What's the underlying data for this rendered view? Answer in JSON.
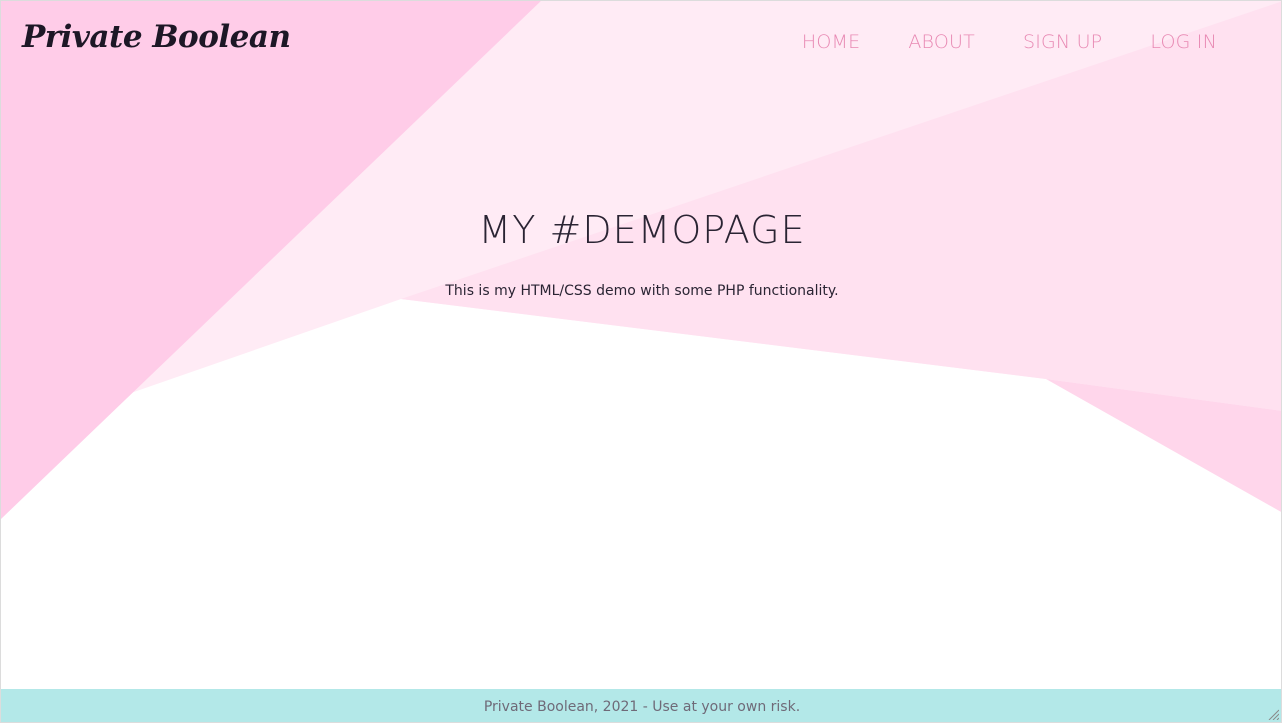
{
  "brand": {
    "logo_text": "Private Boolean"
  },
  "nav": {
    "items": [
      {
        "label": "HOME"
      },
      {
        "label": "ABOUT"
      },
      {
        "label": "SIGN UP"
      },
      {
        "label": "LOG IN"
      }
    ]
  },
  "hero": {
    "title": "MY #DEMOPAGE",
    "subtitle": "This is my HTML/CSS demo with some PHP functionality."
  },
  "footer": {
    "text": "Private Boolean, 2021 - Use at your own risk."
  },
  "colors": {
    "background": "#ffffff",
    "pink_strong": "#ffcce8",
    "pink_light": "#ffebf5",
    "pink_mid": "#ffe1f0",
    "nav_text": "#e889b3",
    "footer_bg": "#b3e8e8",
    "text_dark": "#2a2433"
  }
}
